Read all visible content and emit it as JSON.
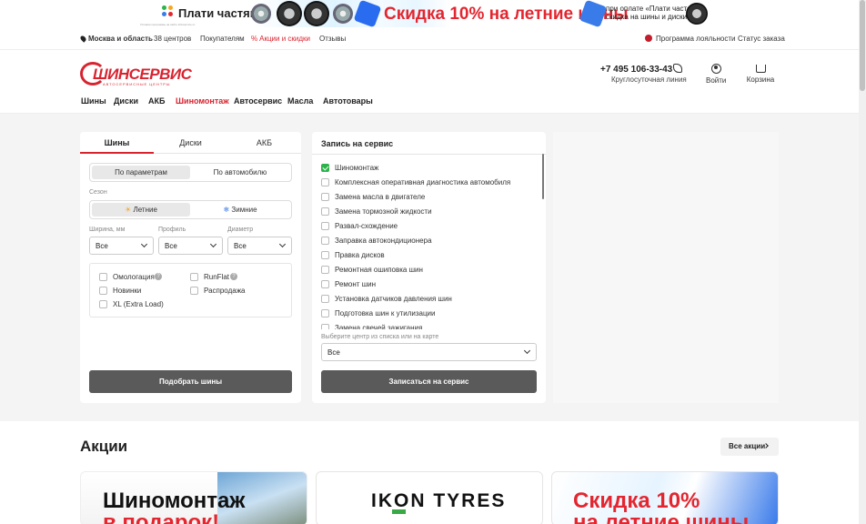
{
  "banner": {
    "brand": "Плати частями",
    "sale_text": "Скидка 10% на летние шины",
    "right_text_1": "при оплате «Плати частями»",
    "right_text_2": "скидка на шины и диски",
    "fine_print": "Условия программы на сайте shinservice.ru"
  },
  "topbar": {
    "city": "Москва и область",
    "centers": "38 центров",
    "customers": "Покупателям",
    "promos": "Акции и скидки",
    "reviews": "Отзывы",
    "loyalty": "Программа лояльности",
    "order_status": "Статус заказа"
  },
  "header": {
    "logo_text": "ШИНСЕРВИС",
    "logo_sub": "АВТОСЕРВИСНЫЕ ЦЕНТРЫ",
    "phone": "+7 495 106-33-43",
    "phone_sub": "Круглосуточная линия",
    "login": "Войти",
    "cart": "Корзина"
  },
  "nav": [
    "Шины",
    "Диски",
    "АКБ",
    "Шиномонтаж",
    "Автосервис",
    "Масла",
    "Автотовары"
  ],
  "nav_active": "Шиномонтаж",
  "search": {
    "tabs": [
      "Шины",
      "Диски",
      "АКБ"
    ],
    "active_tab": "Шины",
    "mode_options": [
      "По параметрам",
      "По автомобилю"
    ],
    "season_label": "Сезон",
    "season_options": [
      "Летние",
      "Зимние"
    ],
    "width_label": "Ширина, мм",
    "profile_label": "Профиль",
    "diameter_label": "Диаметр",
    "width_value": "Все",
    "profile_value": "Все",
    "diameter_value": "Все",
    "options": [
      "Омологация",
      "RunFlat",
      "Новинки",
      "Распродажа",
      "XL (Extra Load)"
    ],
    "submit": "Подобрать шины"
  },
  "service": {
    "title": "Запись на сервис",
    "services": [
      {
        "label": "Шиномонтаж",
        "checked": true
      },
      {
        "label": "Комплексная оперативная диагностика автомобиля",
        "checked": false
      },
      {
        "label": "Замена масла в двигателе",
        "checked": false
      },
      {
        "label": "Замена тормозной жидкости",
        "checked": false
      },
      {
        "label": "Развал-схождение",
        "checked": false
      },
      {
        "label": "Заправка автокондиционера",
        "checked": false
      },
      {
        "label": "Правка дисков",
        "checked": false
      },
      {
        "label": "Ремонтная ошиповка шин",
        "checked": false
      },
      {
        "label": "Ремонт шин",
        "checked": false
      },
      {
        "label": "Установка датчиков давления шин",
        "checked": false
      },
      {
        "label": "Подготовка шин к утилизации",
        "checked": false
      },
      {
        "label": "Замена свечей зажигания",
        "checked": false
      }
    ],
    "center_label": "Выберите центр из списка или на карте",
    "center_value": "Все",
    "submit": "Записаться на сервис"
  },
  "promos": {
    "title": "Акции",
    "all_button": "Все акции",
    "card1_line1": "Шиномонтаж",
    "card1_line2": "в подарок!",
    "card2_brand": "IKON TYRES",
    "card3_line1": "Скидка 10%",
    "card3_line2": "на летние шины"
  }
}
